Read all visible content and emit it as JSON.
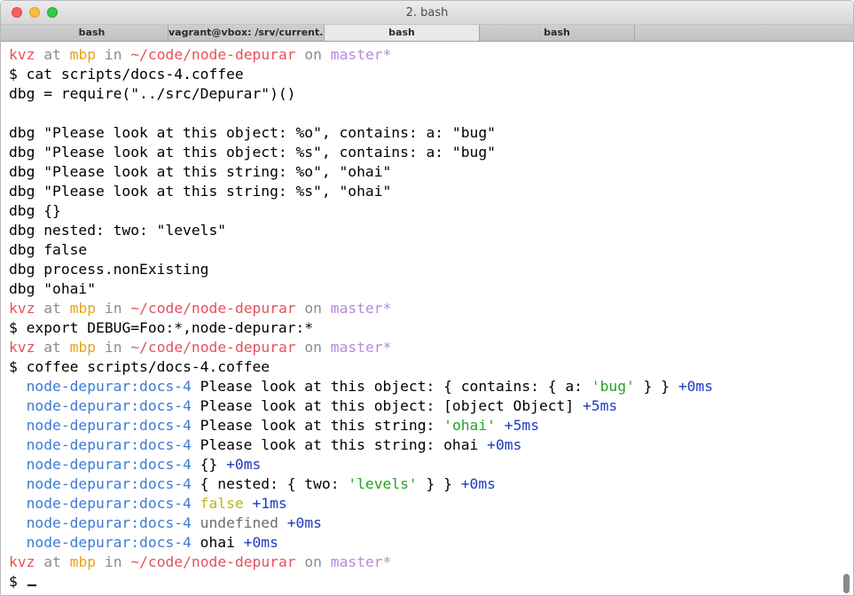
{
  "window": {
    "title": "2. bash",
    "tabs": [
      {
        "label": "bash",
        "active": false
      },
      {
        "label": "vagrant@vbox: /srv/current...",
        "active": false
      },
      {
        "label": "bash",
        "active": true
      },
      {
        "label": "bash",
        "active": false
      }
    ]
  },
  "prompt": {
    "user": "kvz",
    "at": "at",
    "host": "mbp",
    "in": "in",
    "path": "~/code/node-depurar",
    "on": "on",
    "branch": "master*",
    "symbol": "$"
  },
  "commands": {
    "cat": "cat scripts/docs-4.coffee",
    "export": "export DEBUG=Foo:*,node-depurar:*",
    "run": "coffee scripts/docs-4.coffee"
  },
  "source_lines": [
    "dbg = require(\"../src/Depurar\")()",
    "",
    "dbg \"Please look at this object: %o\", contains: a: \"bug\"",
    "dbg \"Please look at this object: %s\", contains: a: \"bug\"",
    "dbg \"Please look at this string: %o\", \"ohai\"",
    "dbg \"Please look at this string: %s\", \"ohai\"",
    "dbg {}",
    "dbg nested: two: \"levels\"",
    "dbg false",
    "dbg process.nonExisting",
    "dbg \"ohai\""
  ],
  "output": {
    "namespace": "node-depurar:docs-4",
    "lines": [
      {
        "pre": "Please look at this object: { contains: { a: ",
        "str": "'bug'",
        "post": " } } ",
        "ms": "+0ms"
      },
      {
        "pre": "Please look at this object: [object Object] ",
        "ms": "+5ms"
      },
      {
        "pre": "Please look at this string: ",
        "str": "'ohai'",
        "post": " ",
        "ms": "+5ms"
      },
      {
        "pre": "Please look at this string: ohai ",
        "ms": "+0ms"
      },
      {
        "pre": "{} ",
        "ms": "+0ms"
      },
      {
        "pre": "{ nested: { two: ",
        "str": "'levels'",
        "post": " } } ",
        "ms": "+0ms"
      },
      {
        "bool": "false",
        "post": " ",
        "ms": "+1ms"
      },
      {
        "undef": "undefined",
        "post": " ",
        "ms": "+0ms"
      },
      {
        "pre": "ohai ",
        "ms": "+0ms"
      }
    ]
  },
  "colors": {
    "prompt_user": "#e8505c",
    "prompt_host": "#e7a21c",
    "prompt_branch": "#b58bd8",
    "namespace": "#3b7bd6",
    "timing": "#1e3bbf",
    "string": "#23a323",
    "boolean": "#b8b81c"
  }
}
